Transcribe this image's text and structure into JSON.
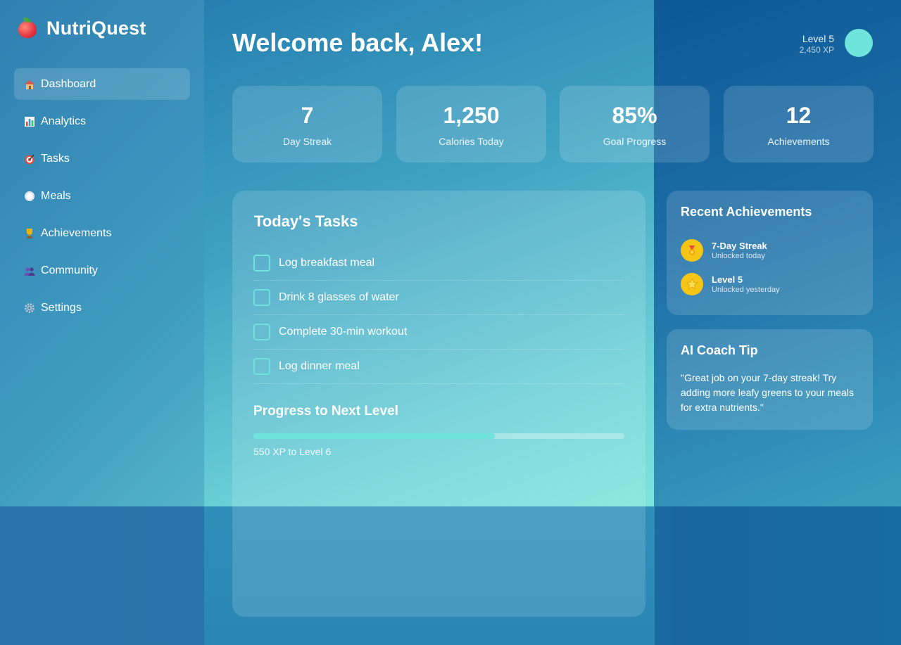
{
  "app": {
    "name": "NutriQuest"
  },
  "sidebar": {
    "items": [
      {
        "label": "Dashboard",
        "icon": "house-icon",
        "active": true
      },
      {
        "label": "Analytics",
        "icon": "bar-chart-icon",
        "active": false
      },
      {
        "label": "Tasks",
        "icon": "target-icon",
        "active": false
      },
      {
        "label": "Meals",
        "icon": "plate-icon",
        "active": false
      },
      {
        "label": "Achievements",
        "icon": "trophy-icon",
        "active": false
      },
      {
        "label": "Community",
        "icon": "people-icon",
        "active": false
      },
      {
        "label": "Settings",
        "icon": "gear-icon",
        "active": false
      }
    ]
  },
  "header": {
    "welcome": "Welcome back, Alex!",
    "level": "Level 5",
    "xp": "2,450 XP"
  },
  "stats": [
    {
      "value": "7",
      "label": "Day Streak"
    },
    {
      "value": "1,250",
      "label": "Calories Today"
    },
    {
      "value": "85%",
      "label": "Goal Progress"
    },
    {
      "value": "12",
      "label": "Achievements"
    }
  ],
  "tasks": {
    "title": "Today's Tasks",
    "items": [
      {
        "label": "Log breakfast meal",
        "done": false
      },
      {
        "label": "Drink 8 glasses of water",
        "done": false
      },
      {
        "label": "Complete 30-min workout",
        "done": false
      },
      {
        "label": "Log dinner meal",
        "done": false
      }
    ]
  },
  "progress": {
    "title": "Progress to Next Level",
    "fraction": 0.65,
    "caption": "550 XP to Level 6"
  },
  "achievements": {
    "title": "Recent Achievements",
    "items": [
      {
        "name": "7-Day Streak",
        "sub": "Unlocked today",
        "icon": "medal-icon"
      },
      {
        "name": "Level 5",
        "sub": "Unlocked yesterday",
        "icon": "star-icon"
      }
    ]
  },
  "tip": {
    "title": "AI Coach Tip",
    "text": "\"Great job on your 7-day streak! Try adding more leafy greens to your meals for extra nutrients.\""
  },
  "colors": {
    "accent": "#6fe3dc",
    "badge": "#f5c518"
  }
}
